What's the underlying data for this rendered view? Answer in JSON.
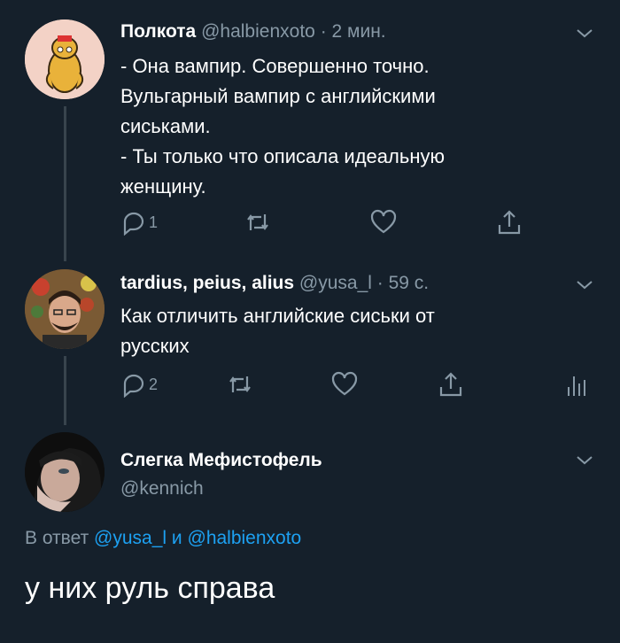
{
  "tweets": [
    {
      "name": "Полкота",
      "handle": "@halbienxoto",
      "time": "· 2 мин.",
      "text": "- Она вампир. Совершенно точно.\nВульгарный вампир с английскими\nсиськами.\n- Ты только что описала идеальную\nженщину.",
      "reply_count": "1"
    },
    {
      "name": "tardius, peius, alius",
      "handle": "@yusa_l",
      "time": "· 59 с.",
      "text": "Как отличить английские сиськи от\nрусских",
      "reply_count": "2"
    }
  ],
  "main_tweet": {
    "name": "Слегка Мефистофель",
    "handle": "@kennich",
    "reply_prefix": "В ответ",
    "reply_user1": "@yusa_l",
    "reply_and": "и",
    "reply_user2": "@halbienxoto",
    "text": "у них руль справа"
  },
  "icons": {
    "reply": "reply-icon",
    "retweet": "retweet-icon",
    "like": "heart-icon",
    "share": "share-icon",
    "analytics": "analytics-icon",
    "more": "chevron-down-icon"
  },
  "colors": {
    "background": "#15202b",
    "secondary_text": "#8899a6",
    "accent": "#1da1f2",
    "thread_line": "#38444d"
  }
}
